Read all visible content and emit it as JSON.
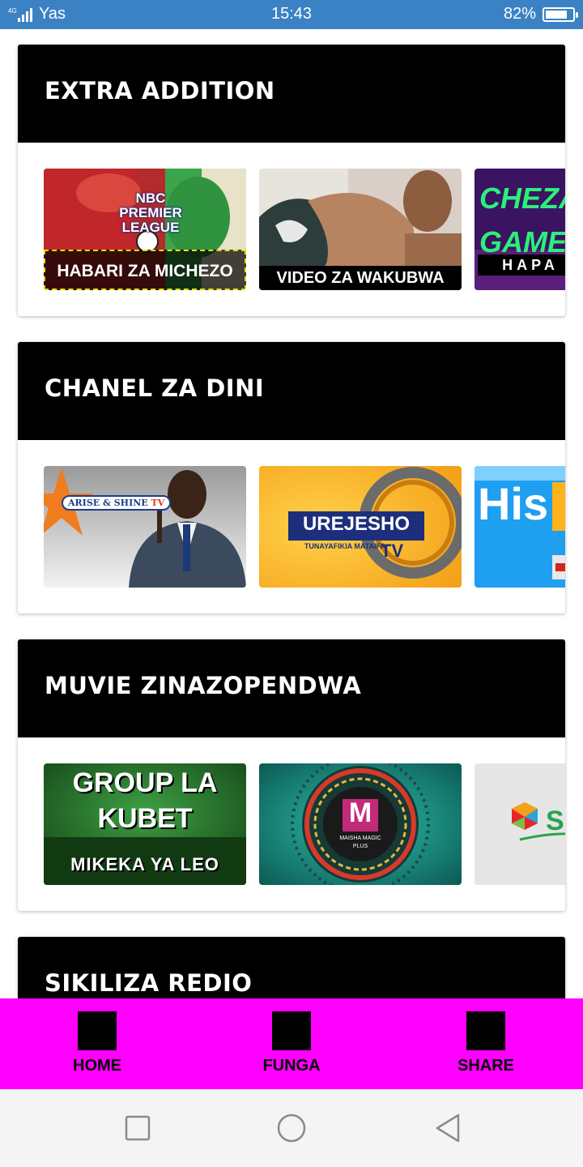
{
  "status_bar": {
    "network_type": "4G",
    "carrier": "Yas",
    "time": "15:43",
    "battery_percent_text": "82%",
    "battery_level": 0.82,
    "background_color": "#3b82c4"
  },
  "sections": [
    {
      "title": "EXTRA ADDITION",
      "tiles": [
        {
          "caption": "HABARI ZA MICHEZO",
          "logo_lines": [
            "NBC",
            "PREMIER",
            "LEAGUE"
          ]
        },
        {
          "caption": "VIDEO ZA WAKUBWA"
        },
        {
          "lines": [
            "CHEZA",
            "GAME",
            "HAPA"
          ]
        }
      ]
    },
    {
      "title": "CHANEL ZA DINI",
      "tiles": [
        {
          "logo": "ARISE & SHINE",
          "logo_suffix": "TV"
        },
        {
          "logo": "UREJESHO",
          "tagline": "TUNAYAFIKIA MATAIFA",
          "logo_suffix": "TV"
        },
        {
          "logo": "His"
        }
      ]
    },
    {
      "title": "MUVIE ZINAZOPENDWA",
      "tiles": [
        {
          "lines": [
            "GROUP LA",
            "KUBET",
            "MIKEKA YA LEO"
          ]
        },
        {
          "logo_letter": "M",
          "logo_lines": [
            "MAISHA MAGIC",
            "PLUS"
          ]
        },
        {
          "logo": "S"
        }
      ]
    },
    {
      "title": "SIKILIZA REDIO"
    }
  ],
  "bottom_nav": {
    "background_color": "#ff00ff",
    "items": [
      {
        "label": "HOME",
        "icon": "home-icon"
      },
      {
        "label": "FUNGA",
        "icon": "close-app-icon"
      },
      {
        "label": "SHARE",
        "icon": "share-icon"
      }
    ]
  },
  "system_nav": {
    "buttons": [
      "recents-icon",
      "home-circle-icon",
      "back-triangle-icon"
    ]
  }
}
